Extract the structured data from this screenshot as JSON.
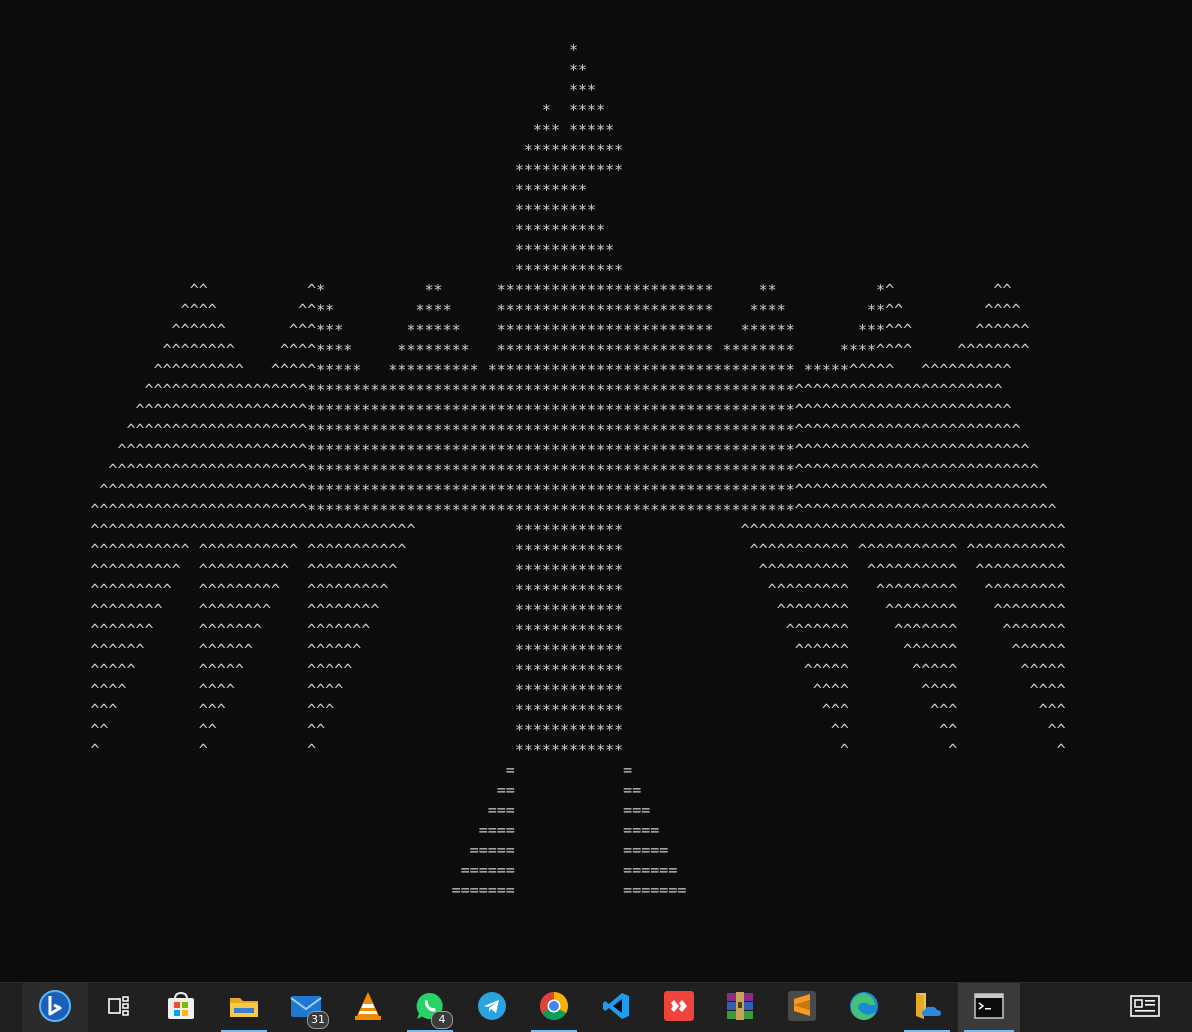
{
  "terminal": {
    "title": "Command Prompt",
    "art_lines": [
      "                                                                 *",
      "                                                                 **",
      "                                                                 ***",
      "                                                              *  ****",
      "                                                             *** *****",
      "                                                            ***********",
      "                                                           ************",
      "                                                           ********",
      "                                                           *********",
      "                                                           **********",
      "                                                           ***********",
      "                                                           ************",
      "                       ^^           ^*           **      ************************     **           *^           ^^",
      "                      ^^^^         ^^**         ****     ************************    ****         **^^         ^^^^",
      "                     ^^^^^^       ^^^***       ******    ************************   ******       ***^^^       ^^^^^^",
      "                    ^^^^^^^^     ^^^^****     ********   ************************ ********     ****^^^^     ^^^^^^^^",
      "                   ^^^^^^^^^^   ^^^^^*****   ********** ********************************** *****^^^^^   ^^^^^^^^^^",
      "                  ^^^^^^^^^^^^^^^^^^******************************************************^^^^^^^^^^^^^^^^^^^^^^^",
      "                 ^^^^^^^^^^^^^^^^^^^******************************************************^^^^^^^^^^^^^^^^^^^^^^^^",
      "                ^^^^^^^^^^^^^^^^^^^^******************************************************^^^^^^^^^^^^^^^^^^^^^^^^^",
      "               ^^^^^^^^^^^^^^^^^^^^^******************************************************^^^^^^^^^^^^^^^^^^^^^^^^^^",
      "              ^^^^^^^^^^^^^^^^^^^^^^******************************************************^^^^^^^^^^^^^^^^^^^^^^^^^^^",
      "             ^^^^^^^^^^^^^^^^^^^^^^^******************************************************^^^^^^^^^^^^^^^^^^^^^^^^^^^^",
      "            ^^^^^^^^^^^^^^^^^^^^^^^^******************************************************^^^^^^^^^^^^^^^^^^^^^^^^^^^^^",
      "            ^^^^^^^^^^^^^^^^^^^^^^^^^^^^^^^^^^^^           ************             ^^^^^^^^^^^^^^^^^^^^^^^^^^^^^^^^^^^^",
      "            ^^^^^^^^^^^ ^^^^^^^^^^^ ^^^^^^^^^^^            ************              ^^^^^^^^^^^ ^^^^^^^^^^^ ^^^^^^^^^^^",
      "            ^^^^^^^^^^  ^^^^^^^^^^  ^^^^^^^^^^             ************               ^^^^^^^^^^  ^^^^^^^^^^  ^^^^^^^^^^",
      "            ^^^^^^^^^   ^^^^^^^^^   ^^^^^^^^^              ************                ^^^^^^^^^   ^^^^^^^^^   ^^^^^^^^^",
      "            ^^^^^^^^    ^^^^^^^^    ^^^^^^^^               ************                 ^^^^^^^^    ^^^^^^^^    ^^^^^^^^",
      "            ^^^^^^^     ^^^^^^^     ^^^^^^^                ************                  ^^^^^^^     ^^^^^^^     ^^^^^^^",
      "            ^^^^^^      ^^^^^^      ^^^^^^                 ************                   ^^^^^^      ^^^^^^      ^^^^^^",
      "            ^^^^^       ^^^^^       ^^^^^                  ************                    ^^^^^       ^^^^^       ^^^^^",
      "            ^^^^        ^^^^        ^^^^                   ************                     ^^^^        ^^^^        ^^^^",
      "            ^^^         ^^^         ^^^                    ************                      ^^^         ^^^         ^^^",
      "            ^^          ^^          ^^                     ************                       ^^          ^^          ^^",
      "            ^           ^           ^                      ************                        ^           ^           ^",
      "                                                          =            =",
      "                                                         ==            ==",
      "                                                        ===            ===",
      "                                                       ====            ====",
      "                                                      =====            =====",
      "                                                     ======            ======",
      "                                                    =======            ======="
    ]
  },
  "taskbar": {
    "mail_badge": "31",
    "whatsapp_badge": "4",
    "colors": {
      "background": "#202020",
      "accent": "#76b9ed"
    },
    "icons": [
      "bing-chat-icon",
      "task-view-icon",
      "microsoft-store-icon",
      "file-explorer-icon",
      "mail-icon",
      "vlc-icon",
      "whatsapp-icon",
      "telegram-icon",
      "chrome-icon",
      "vscode-icon",
      "anydesk-icon",
      "winrar-icon",
      "sublime-text-icon",
      "edge-icon",
      "onedrive-folder-icon",
      "command-prompt-icon",
      "news-widget-icon"
    ]
  }
}
